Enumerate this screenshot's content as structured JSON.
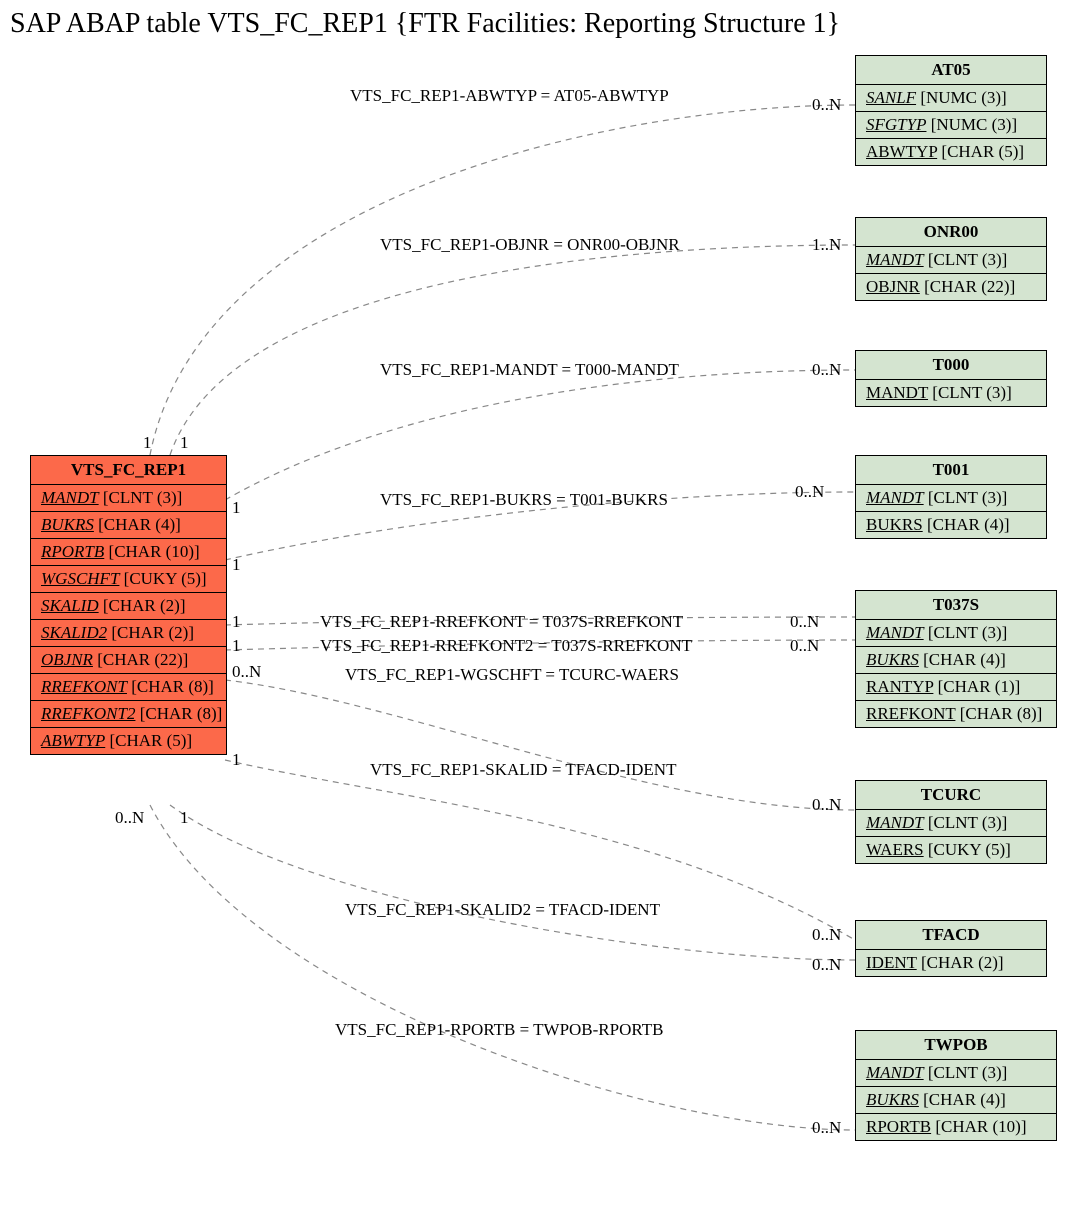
{
  "title": "SAP ABAP table VTS_FC_REP1 {FTR Facilities: Reporting Structure 1}",
  "main_entity": {
    "name": "VTS_FC_REP1",
    "fields": [
      {
        "name": "MANDT",
        "type": "[CLNT (3)]",
        "italic": true
      },
      {
        "name": "BUKRS",
        "type": "[CHAR (4)]",
        "italic": true
      },
      {
        "name": "RPORTB",
        "type": "[CHAR (10)]",
        "italic": true
      },
      {
        "name": "WGSCHFT",
        "type": "[CUKY (5)]",
        "italic": true
      },
      {
        "name": "SKALID",
        "type": "[CHAR (2)]",
        "italic": true
      },
      {
        "name": "SKALID2",
        "type": "[CHAR (2)]",
        "italic": true
      },
      {
        "name": "OBJNR",
        "type": "[CHAR (22)]",
        "italic": true
      },
      {
        "name": "RREFKONT",
        "type": "[CHAR (8)]",
        "italic": true
      },
      {
        "name": "RREFKONT2",
        "type": "[CHAR (8)]",
        "italic": true
      },
      {
        "name": "ABWTYP",
        "type": "[CHAR (5)]",
        "italic": true
      }
    ]
  },
  "entities": [
    {
      "id": "AT05",
      "name": "AT05",
      "fields": [
        {
          "name": "SANLF",
          "type": "[NUMC (3)]",
          "italic": true
        },
        {
          "name": "SFGTYP",
          "type": "[NUMC (3)]",
          "italic": true
        },
        {
          "name": "ABWTYP",
          "type": "[CHAR (5)]",
          "italic": false
        }
      ]
    },
    {
      "id": "ONR00",
      "name": "ONR00",
      "fields": [
        {
          "name": "MANDT",
          "type": "[CLNT (3)]",
          "italic": true
        },
        {
          "name": "OBJNR",
          "type": "[CHAR (22)]",
          "italic": false
        }
      ]
    },
    {
      "id": "T000",
      "name": "T000",
      "fields": [
        {
          "name": "MANDT",
          "type": "[CLNT (3)]",
          "italic": false
        }
      ]
    },
    {
      "id": "T001",
      "name": "T001",
      "fields": [
        {
          "name": "MANDT",
          "type": "[CLNT (3)]",
          "italic": true
        },
        {
          "name": "BUKRS",
          "type": "[CHAR (4)]",
          "italic": false
        }
      ]
    },
    {
      "id": "T037S",
      "name": "T037S",
      "fields": [
        {
          "name": "MANDT",
          "type": "[CLNT (3)]",
          "italic": true
        },
        {
          "name": "BUKRS",
          "type": "[CHAR (4)]",
          "italic": true
        },
        {
          "name": "RANTYP",
          "type": "[CHAR (1)]",
          "italic": false
        },
        {
          "name": "RREFKONT",
          "type": "[CHAR (8)]",
          "italic": false
        }
      ]
    },
    {
      "id": "TCURC",
      "name": "TCURC",
      "fields": [
        {
          "name": "MANDT",
          "type": "[CLNT (3)]",
          "italic": true
        },
        {
          "name": "WAERS",
          "type": "[CUKY (5)]",
          "italic": false
        }
      ]
    },
    {
      "id": "TFACD",
      "name": "TFACD",
      "fields": [
        {
          "name": "IDENT",
          "type": "[CHAR (2)]",
          "italic": false
        }
      ]
    },
    {
      "id": "TWPOB",
      "name": "TWPOB",
      "fields": [
        {
          "name": "MANDT",
          "type": "[CLNT (3)]",
          "italic": true
        },
        {
          "name": "BUKRS",
          "type": "[CHAR (4)]",
          "italic": true
        },
        {
          "name": "RPORTB",
          "type": "[CHAR (10)]",
          "italic": false
        }
      ]
    }
  ],
  "relations": [
    {
      "label": "VTS_FC_REP1-ABWTYP = AT05-ABWTYP",
      "left_card": "1",
      "right_card": "0..N"
    },
    {
      "label": "VTS_FC_REP1-OBJNR = ONR00-OBJNR",
      "left_card": "1",
      "right_card": "1..N"
    },
    {
      "label": "VTS_FC_REP1-MANDT = T000-MANDT",
      "left_card": "1",
      "right_card": "0..N"
    },
    {
      "label": "VTS_FC_REP1-BUKRS = T001-BUKRS",
      "left_card": "1",
      "right_card": "0..N"
    },
    {
      "label": "VTS_FC_REP1-RREFKONT = T037S-RREFKONT",
      "left_card": "1",
      "right_card": "0..N"
    },
    {
      "label": "VTS_FC_REP1-RREFKONT2 = T037S-RREFKONT",
      "left_card": "1",
      "right_card": "0..N"
    },
    {
      "label": "VTS_FC_REP1-WGSCHFT = TCURC-WAERS",
      "left_card": "0..N",
      "right_card": "0..N"
    },
    {
      "label": "VTS_FC_REP1-SKALID = TFACD-IDENT",
      "left_card": "1",
      "right_card": "0..N"
    },
    {
      "label": "VTS_FC_REP1-SKALID2 = TFACD-IDENT",
      "left_card": "0..N",
      "right_card": "0..N"
    },
    {
      "label": "VTS_FC_REP1-RPORTB = TWPOB-RPORTB",
      "left_card": "1",
      "right_card": "0..N"
    }
  ]
}
